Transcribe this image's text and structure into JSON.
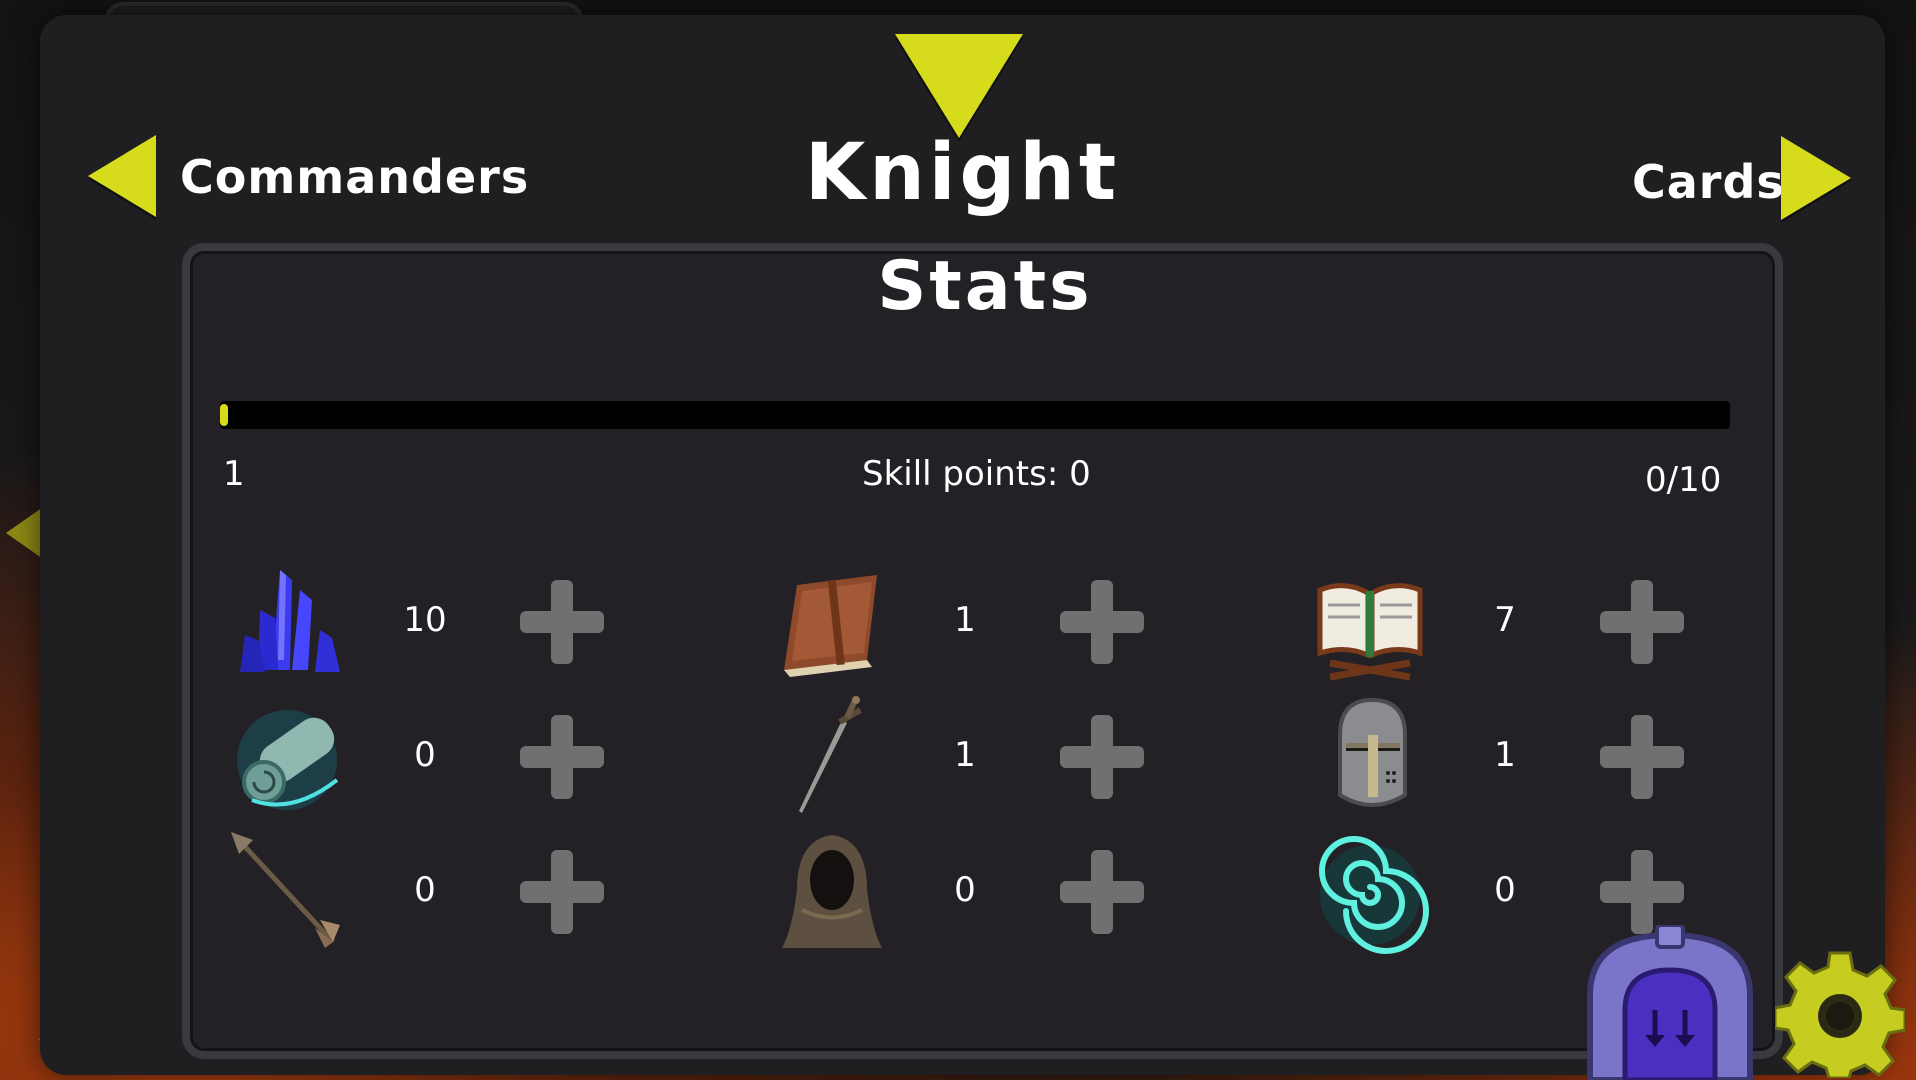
{
  "header": {
    "title": "Knight",
    "prev_label": "Commanders",
    "next_label": "Cards"
  },
  "stats_panel": {
    "title": "Stats",
    "level": "1",
    "skill_points": "Skill points: 0",
    "xp": "0/10",
    "xp_fraction": 0.0
  },
  "stats": [
    {
      "icon": "mana-crystal-icon",
      "value": "10"
    },
    {
      "icon": "leather-book-icon",
      "value": "1"
    },
    {
      "icon": "open-book-icon",
      "value": "7"
    },
    {
      "icon": "magic-scroll-icon",
      "value": "0"
    },
    {
      "icon": "dagger-icon",
      "value": "1"
    },
    {
      "icon": "knight-helmet-icon",
      "value": "1"
    },
    {
      "icon": "arrow-icon",
      "value": "0"
    },
    {
      "icon": "hooded-cloak-icon",
      "value": "0"
    },
    {
      "icon": "teal-vortex-icon",
      "value": "0"
    }
  ],
  "colors": {
    "accent": "#d6dc1c",
    "panel": "#232125",
    "plus": "#707070"
  }
}
